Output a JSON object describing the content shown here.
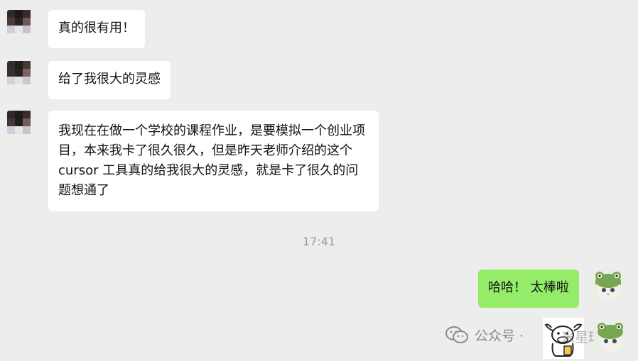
{
  "chat": {
    "messages": [
      {
        "side": "left",
        "text": "真的很有用！"
      },
      {
        "side": "left",
        "text": "给了我很大的灵感"
      },
      {
        "side": "left",
        "text": "我现在在做一个学校的课程作业，是要模拟一个创业项目，本来我卡了很久很久，但是昨天老师介绍的这个cursor 工具真的给我很大的灵感，就是卡了很久的问题想通了"
      },
      {
        "side": "right",
        "text": "哈哈！ 太棒啦"
      }
    ],
    "timestamp": "17:41"
  },
  "watermark": {
    "label": "公众号 ·",
    "overlay_text": "米星球"
  },
  "colors": {
    "background": "#ededed",
    "incoming_bubble": "#ffffff",
    "outgoing_bubble": "#95ec69",
    "timestamp": "#9a9a9a"
  }
}
